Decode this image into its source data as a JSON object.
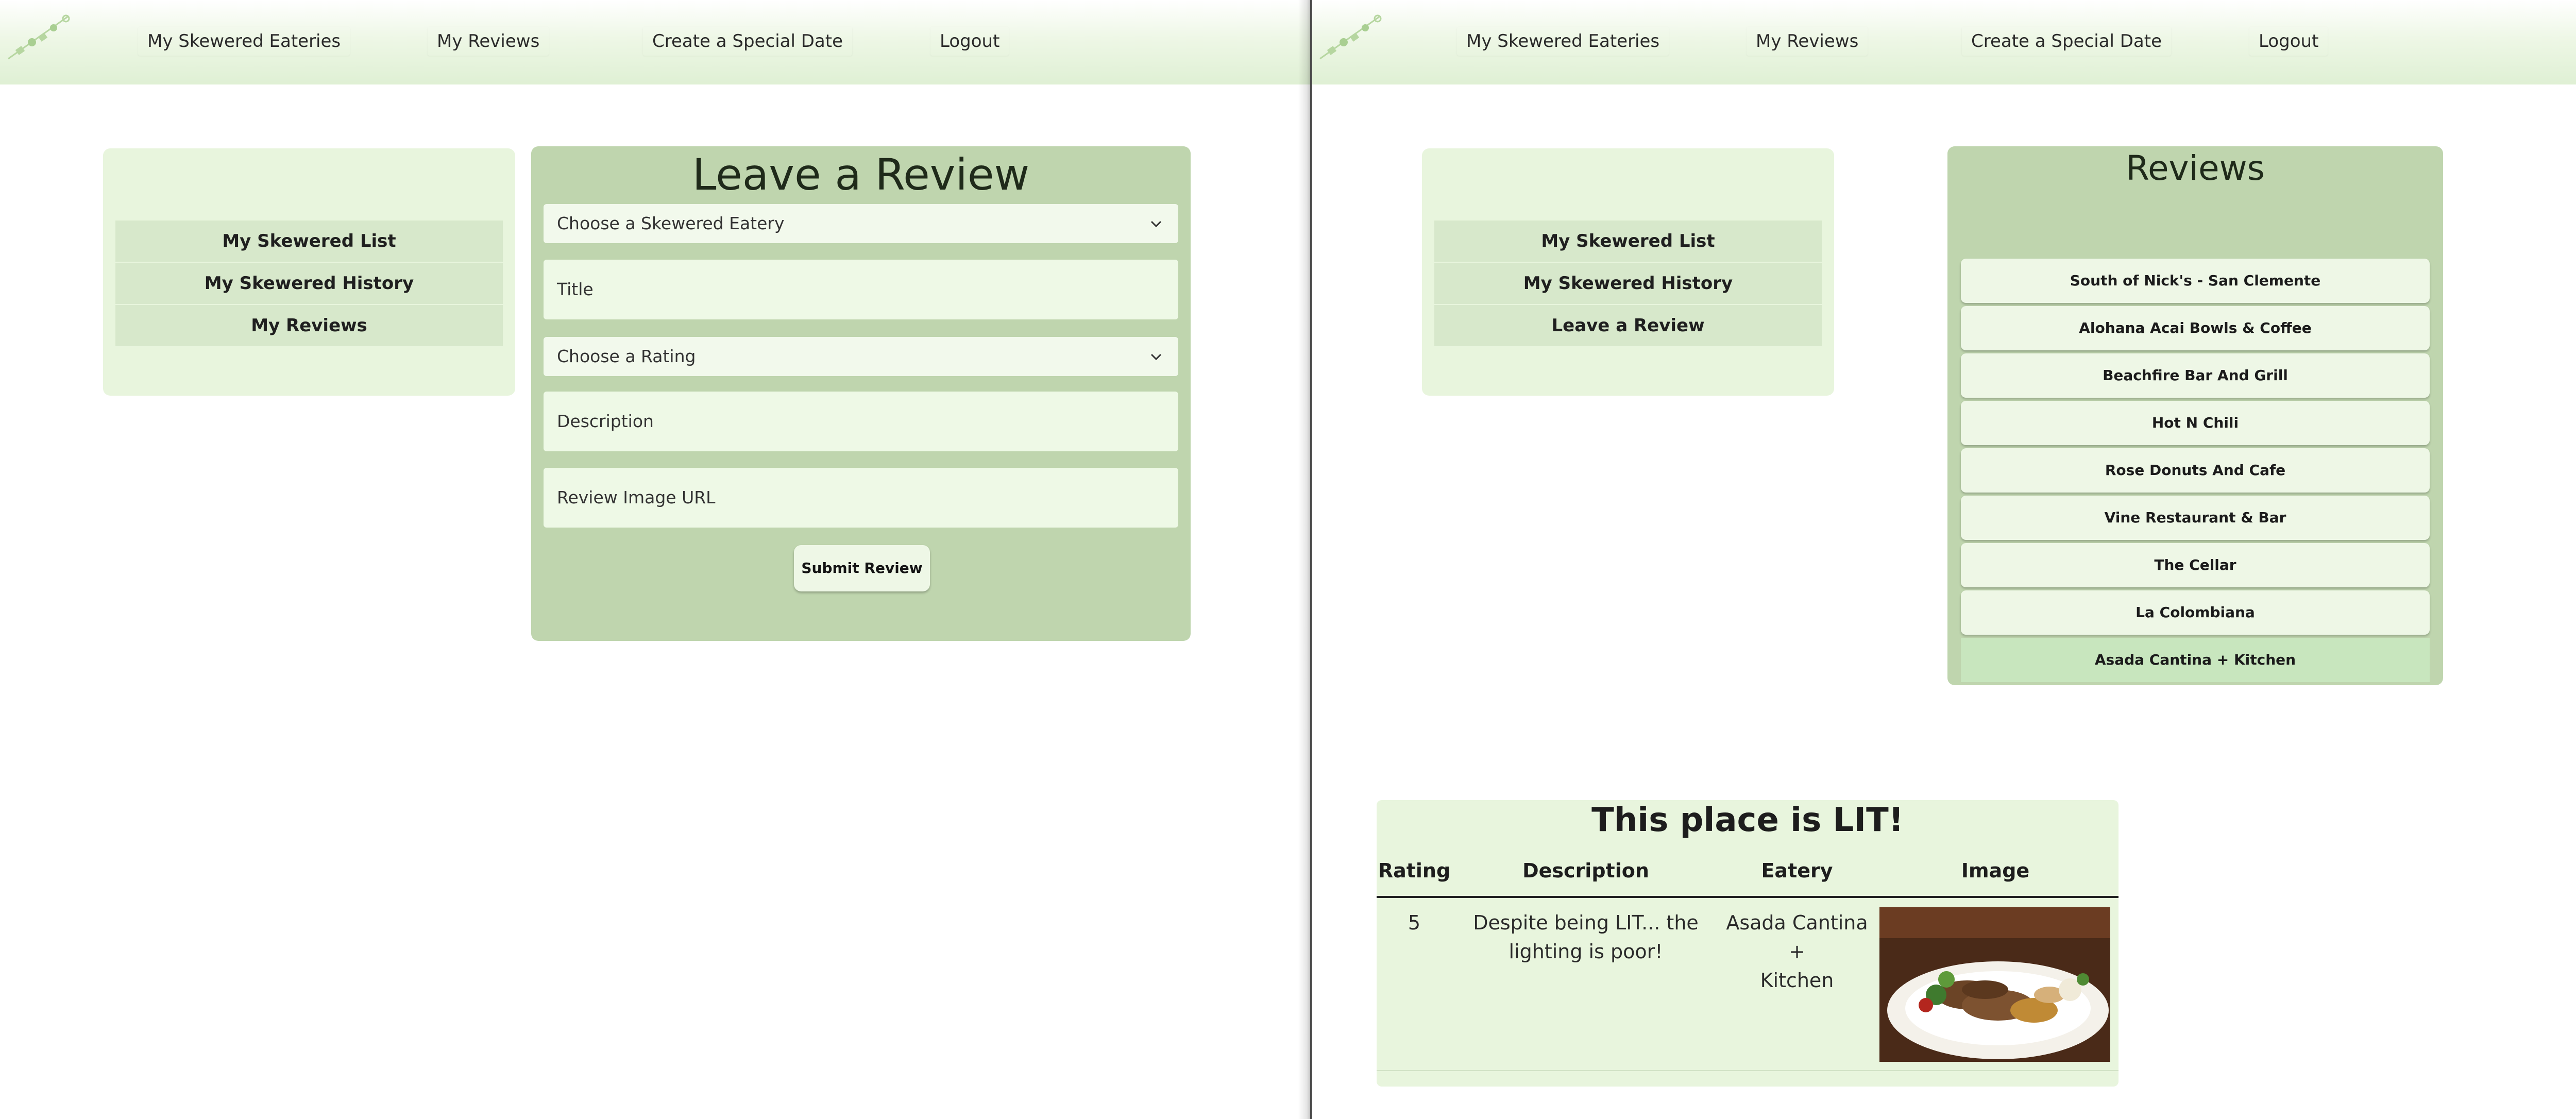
{
  "nav": {
    "items": [
      "My Skewered Eateries",
      "My Reviews",
      "Create a Special Date",
      "Logout"
    ]
  },
  "left_pane": {
    "sidebar": [
      "My Skewered List",
      "My Skewered History",
      "My Reviews"
    ],
    "form": {
      "title": "Leave a Review",
      "eatery_select": "Choose a Skewered Eatery",
      "title_placeholder": "Title",
      "rating_select": "Choose a Rating",
      "description_placeholder": "Description",
      "image_url_placeholder": "Review Image URL",
      "submit_label": "Submit Review"
    }
  },
  "right_pane": {
    "sidebar": [
      "My Skewered List",
      "My Skewered History",
      "Leave a Review"
    ],
    "reviews": {
      "title": "Reviews",
      "items": [
        "South of Nick's - San Clemente",
        "Alohana Acai Bowls & Coffee",
        "Beachfire Bar And Grill",
        "Hot N Chili",
        "Rose Donuts And Cafe",
        "Vine Restaurant & Bar",
        "The Cellar",
        "La Colombiana",
        "Asada Cantina + Kitchen"
      ],
      "selected_index": 8
    },
    "detail": {
      "title": "This place is LIT!",
      "headers": [
        "Rating",
        "Description",
        "Eatery",
        "Image"
      ],
      "row": {
        "rating": "5",
        "description_line1": "Despite being LIT... the",
        "description_line2": "lighting is poor!",
        "eatery_line1": "Asada Cantina +",
        "eatery_line2": "Kitchen"
      }
    }
  },
  "colors": {
    "card_green": "#bfd5ae",
    "panel_light": "#e8f5dd",
    "field_bg": "#eef9e6",
    "selected_item": "#c8e6be"
  }
}
